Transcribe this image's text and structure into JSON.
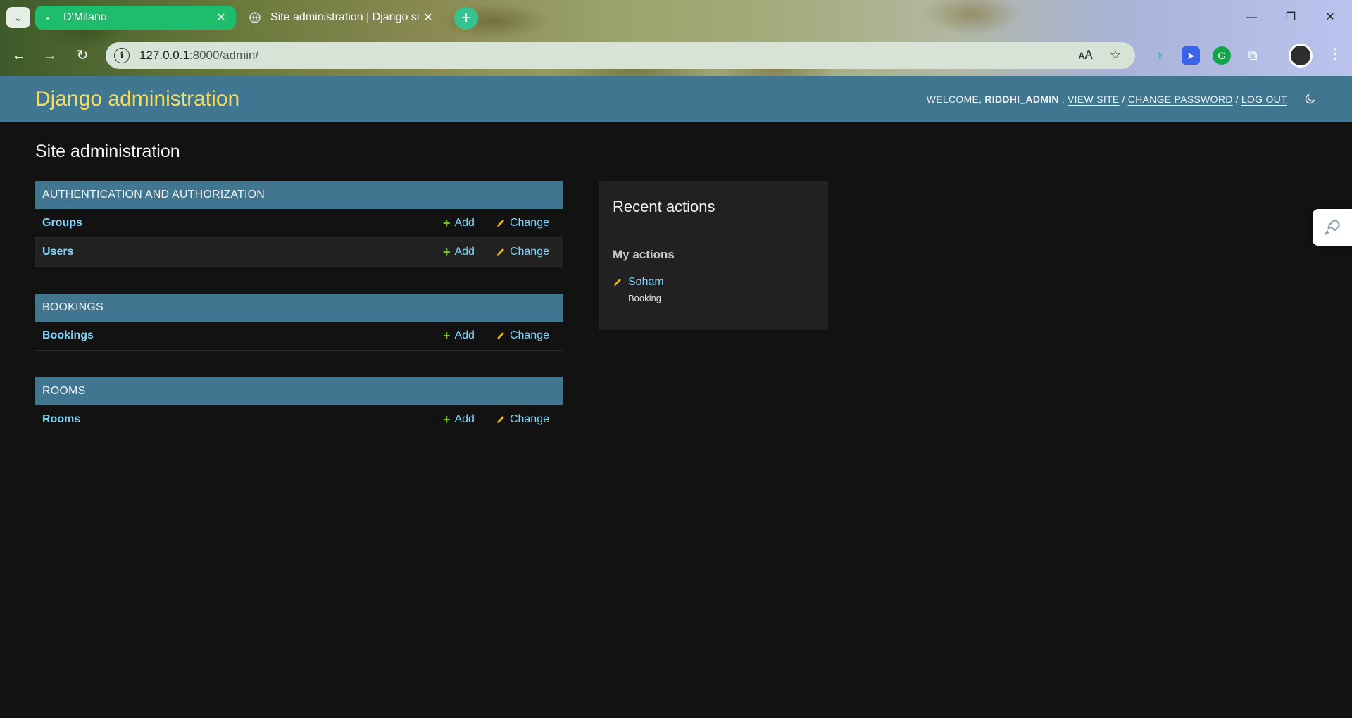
{
  "browser": {
    "tabs": [
      {
        "title": "D'Milano",
        "active": true
      },
      {
        "title": "Site administration | Django site",
        "active": false
      }
    ],
    "url_host": "127.0.0.1",
    "url_path": ":8000/admin/"
  },
  "header": {
    "brand": "Django administration",
    "welcome": "Welcome,",
    "username": "riddhi_admin",
    "view_site": "View site",
    "change_password": "Change password",
    "log_out": "Log out",
    "sep": "/"
  },
  "page_title": "Site administration",
  "modules": [
    {
      "caption": "Authentication and Authorization",
      "rows": [
        {
          "name": "Groups",
          "add": "Add",
          "change": "Change"
        },
        {
          "name": "Users",
          "add": "Add",
          "change": "Change"
        }
      ]
    },
    {
      "caption": "Bookings",
      "rows": [
        {
          "name": "Bookings",
          "add": "Add",
          "change": "Change"
        }
      ]
    },
    {
      "caption": "Rooms",
      "rows": [
        {
          "name": "Rooms",
          "add": "Add",
          "change": "Change"
        }
      ]
    }
  ],
  "recent": {
    "title": "Recent actions",
    "subtitle": "My actions",
    "items": [
      {
        "label": "Soham",
        "type": "Booking"
      }
    ]
  },
  "colors": {
    "header_bg": "#417690",
    "brand": "#f5dd5d",
    "link": "#81d4fa",
    "add_icon": "#70bf2b",
    "change_icon": "#efb80b",
    "page_bg": "#121212"
  }
}
